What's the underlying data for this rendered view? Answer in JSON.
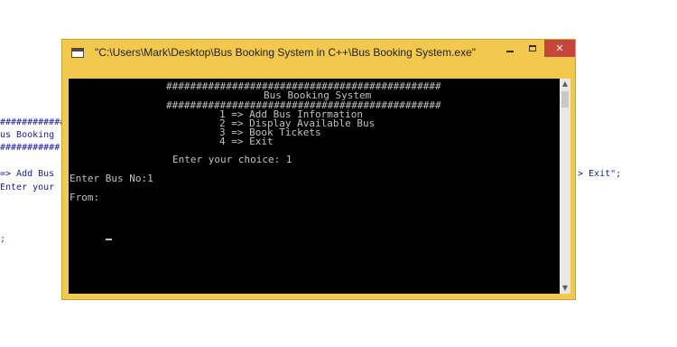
{
  "background_code": {
    "line1": "############",
    "line2": "us Booking",
    "line3": "###########",
    "line4": "=> Add Bus",
    "line5": "Enter your",
    "line6": ";",
    "right_fragment": "> Exit\";"
  },
  "window": {
    "title": "\"C:\\Users\\Mark\\Desktop\\Bus Booking System in C++\\Bus Booking System.exe\"",
    "minimize_glyph": "_",
    "maximize_glyph": "□",
    "close_glyph": "✕"
  },
  "console": {
    "rule_top": "##############################################",
    "heading": "Bus Booking System",
    "rule_bottom": "##############################################",
    "menu": [
      "1 => Add Bus Information",
      "2 => Display Available Bus",
      "3 => Book Tickets",
      "4 => Exit"
    ],
    "choice_prompt": "Enter your choice: 1",
    "bus_no_prompt": "Enter Bus No:1",
    "from_prompt": "From: "
  },
  "scrollbar": {
    "up_glyph": "▲",
    "down_glyph": "▼"
  },
  "colors": {
    "window_frame": "#f2c94c",
    "console_bg": "#000000",
    "console_text": "#c0c0c0",
    "close_button": "#c7463a"
  }
}
